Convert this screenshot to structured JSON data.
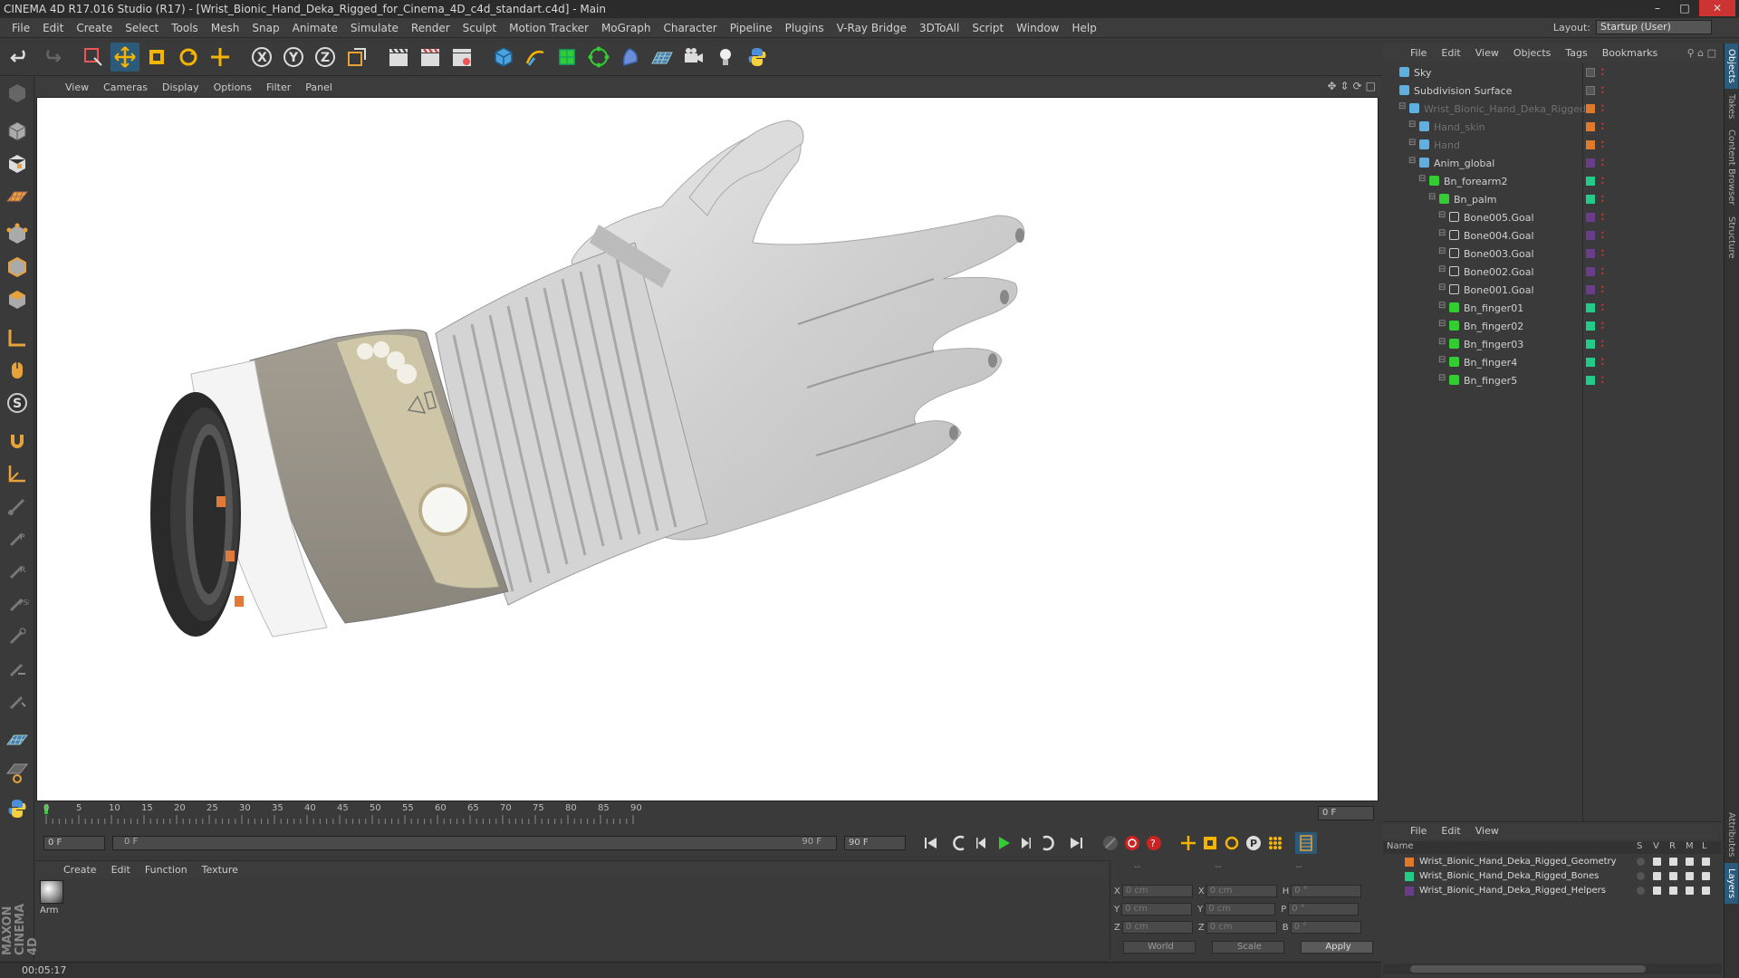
{
  "window": {
    "title": "CINEMA 4D R17.016 Studio (R17) - [Wrist_Bionic_Hand_Deka_Rigged_for_Cinema_4D_c4d_standart.c4d] - Main"
  },
  "menubar": {
    "items": [
      "File",
      "Edit",
      "Create",
      "Select",
      "Tools",
      "Mesh",
      "Snap",
      "Animate",
      "Simulate",
      "Render",
      "Sculpt",
      "Motion Tracker",
      "MoGraph",
      "Character",
      "Pipeline",
      "Plugins",
      "V-Ray Bridge",
      "3DToAll",
      "Script",
      "Window",
      "Help"
    ],
    "layout_label": "Layout:",
    "layout_value": "Startup (User)"
  },
  "viewport": {
    "menu": [
      "View",
      "Cameras",
      "Display",
      "Options",
      "Filter",
      "Panel"
    ]
  },
  "timeline": {
    "ticks": [
      "0",
      "5",
      "10",
      "15",
      "20",
      "25",
      "30",
      "35",
      "40",
      "45",
      "50",
      "55",
      "60",
      "65",
      "70",
      "75",
      "80",
      "85",
      "90"
    ],
    "current_frame": "0 F"
  },
  "transport": {
    "start_field": "0 F",
    "range_left": "0 F",
    "range_right": "90 F",
    "end_field": "90 F"
  },
  "material_manager": {
    "menu": [
      "Create",
      "Edit",
      "Function",
      "Texture"
    ],
    "material_name": "Arm"
  },
  "attributes": {
    "headers": [
      "--",
      "--",
      "--"
    ],
    "pos_x": "0 cm",
    "pos_y": "0 cm",
    "pos_z": "0 cm",
    "size_x": "0 cm",
    "size_y": "0 cm",
    "size_z": "0 cm",
    "rot_h": "0 °",
    "rot_p": "0 °",
    "rot_b": "0 °",
    "labels": {
      "x": "X",
      "y": "Y",
      "z": "Z",
      "h": "H",
      "p": "P",
      "b": "B"
    },
    "coord_mode": "World",
    "size_mode": "Scale",
    "apply_label": "Apply"
  },
  "status": {
    "time": "00:05:17"
  },
  "object_manager": {
    "menu": [
      "File",
      "Edit",
      "View",
      "Objects",
      "Tags",
      "Bookmarks"
    ],
    "objects": [
      {
        "name": "Sky",
        "indent": 0,
        "layer_color": "",
        "dim": false
      },
      {
        "name": "Subdivision Surface",
        "indent": 0,
        "layer_color": "",
        "dim": false
      },
      {
        "name": "Wrist_Bionic_Hand_Deka_Rigged",
        "indent": 1,
        "layer_color": "#e07a2a",
        "dim": true
      },
      {
        "name": "Hand_skin",
        "indent": 2,
        "layer_color": "#e07a2a",
        "dim": true
      },
      {
        "name": "Hand",
        "indent": 2,
        "layer_color": "#e07a2a",
        "dim": true
      },
      {
        "name": "Anim_global",
        "indent": 2,
        "layer_color": "#6a3d8a",
        "dim": false
      },
      {
        "name": "Bn_forearm2",
        "indent": 3,
        "layer_color": "#22cc88",
        "dim": false
      },
      {
        "name": "Bn_palm",
        "indent": 4,
        "layer_color": "#22cc88",
        "dim": false
      },
      {
        "name": "Bone005.Goal",
        "indent": 5,
        "layer_color": "#6a3d8a",
        "dim": false
      },
      {
        "name": "Bone004.Goal",
        "indent": 5,
        "layer_color": "#6a3d8a",
        "dim": false
      },
      {
        "name": "Bone003.Goal",
        "indent": 5,
        "layer_color": "#6a3d8a",
        "dim": false
      },
      {
        "name": "Bone002.Goal",
        "indent": 5,
        "layer_color": "#6a3d8a",
        "dim": false
      },
      {
        "name": "Bone001.Goal",
        "indent": 5,
        "layer_color": "#6a3d8a",
        "dim": false
      },
      {
        "name": "Bn_finger01",
        "indent": 5,
        "layer_color": "#22cc88",
        "dim": false
      },
      {
        "name": "Bn_finger02",
        "indent": 5,
        "layer_color": "#22cc88",
        "dim": false
      },
      {
        "name": "Bn_finger03",
        "indent": 5,
        "layer_color": "#22cc88",
        "dim": false
      },
      {
        "name": "Bn_finger4",
        "indent": 5,
        "layer_color": "#22cc88",
        "dim": false
      },
      {
        "name": "Bn_finger5",
        "indent": 5,
        "layer_color": "#22cc88",
        "dim": false
      }
    ]
  },
  "layer_manager": {
    "menu": [
      "File",
      "Edit",
      "View"
    ],
    "columns": [
      "Name",
      "S",
      "V",
      "R",
      "M",
      "L"
    ],
    "layers": [
      {
        "name": "Wrist_Bionic_Hand_Deka_Rigged_Geometry",
        "color": "#e07a2a"
      },
      {
        "name": "Wrist_Bionic_Hand_Deka_Rigged_Bones",
        "color": "#22cc88"
      },
      {
        "name": "Wrist_Bionic_Hand_Deka_Rigged_Helpers",
        "color": "#6a3d8a"
      }
    ]
  },
  "side_tabs": [
    "Objects",
    "Takes",
    "Content Browser",
    "Structure",
    "Attributes",
    "Layers"
  ],
  "colors": {
    "accent": "#2b5a7a",
    "play_green": "#33aa33",
    "record_red": "#cc2222"
  }
}
